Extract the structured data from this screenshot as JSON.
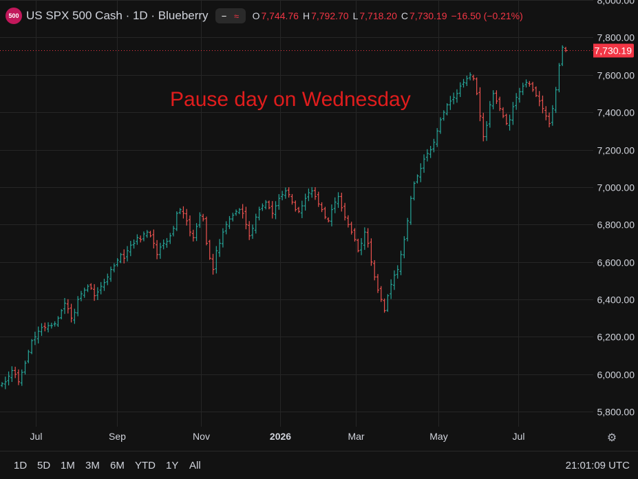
{
  "header": {
    "symbol_badge": "500",
    "title": "US SPX 500 Cash · 1D · Blueberry",
    "controls": [
      "−",
      "≈"
    ],
    "ohlc": {
      "o_label": "O",
      "o_value": "7,744.76",
      "h_label": "H",
      "h_value": "7,792.70",
      "l_label": "L",
      "l_value": "7,718.20",
      "c_label": "C",
      "c_value": "7,730.19",
      "change": "−16.50 (−0.21%)"
    }
  },
  "annotation": "Pause day on Wednesday",
  "last_price_label": "7,730.19",
  "timeframes": [
    "1D",
    "5D",
    "1M",
    "3M",
    "6M",
    "YTD",
    "1Y",
    "All"
  ],
  "clock": "21:01:09 UTC",
  "colors": {
    "background": "#121212",
    "grid": "#262626",
    "up": "#26a69a",
    "down": "#ef5350",
    "annotation": "#e01d1d",
    "price_tag": "#f23645"
  },
  "chart_data": {
    "type": "ohlc",
    "title": "US SPX 500 Cash · 1D · Blueberry",
    "y_ticks": [
      "5,800.00",
      "6,000.00",
      "6,200.00",
      "6,400.00",
      "6,600.00",
      "6,800.00",
      "7,000.00",
      "7,200.00",
      "7,400.00",
      "7,600.00",
      "7,800.00",
      "8,000.00"
    ],
    "ylim": [
      5720,
      8000
    ],
    "x_ticks": [
      "Jul",
      "Sep",
      "Nov",
      "2026",
      "Mar",
      "May",
      "Jul"
    ],
    "x_tick_pos": [
      0.06,
      0.197,
      0.339,
      0.472,
      0.6,
      0.739,
      0.874
    ],
    "closes": [
      5950,
      5960,
      5990,
      6020,
      6000,
      5960,
      6010,
      6060,
      6120,
      6180,
      6200,
      6230,
      6250,
      6250,
      6260,
      6260,
      6270,
      6300,
      6340,
      6380,
      6350,
      6300,
      6330,
      6400,
      6430,
      6450,
      6470,
      6460,
      6420,
      6440,
      6470,
      6490,
      6520,
      6560,
      6580,
      6610,
      6640,
      6620,
      6660,
      6690,
      6700,
      6730,
      6720,
      6750,
      6760,
      6740,
      6700,
      6640,
      6680,
      6700,
      6710,
      6740,
      6780,
      6860,
      6880,
      6860,
      6820,
      6760,
      6730,
      6790,
      6850,
      6830,
      6700,
      6620,
      6560,
      6660,
      6700,
      6760,
      6800,
      6830,
      6850,
      6870,
      6880,
      6860,
      6800,
      6740,
      6780,
      6840,
      6880,
      6900,
      6920,
      6890,
      6860,
      6900,
      6940,
      6960,
      6980,
      6960,
      6920,
      6880,
      6870,
      6900,
      6940,
      6970,
      6980,
      6950,
      6910,
      6880,
      6840,
      6820,
      6880,
      6920,
      6950,
      6890,
      6840,
      6800,
      6760,
      6720,
      6660,
      6700,
      6760,
      6700,
      6600,
      6520,
      6450,
      6400,
      6340,
      6420,
      6480,
      6530,
      6560,
      6640,
      6720,
      6820,
      6940,
      7020,
      7060,
      7100,
      7150,
      7180,
      7200,
      7240,
      7300,
      7360,
      7400,
      7440,
      7460,
      7480,
      7500,
      7540,
      7560,
      7580,
      7600,
      7580,
      7500,
      7380,
      7270,
      7330,
      7440,
      7500,
      7460,
      7420,
      7380,
      7340,
      7360,
      7430,
      7480,
      7510,
      7540,
      7560,
      7550,
      7520,
      7490,
      7460,
      7420,
      7380,
      7340,
      7420,
      7520,
      7650,
      7747,
      7730
    ]
  }
}
